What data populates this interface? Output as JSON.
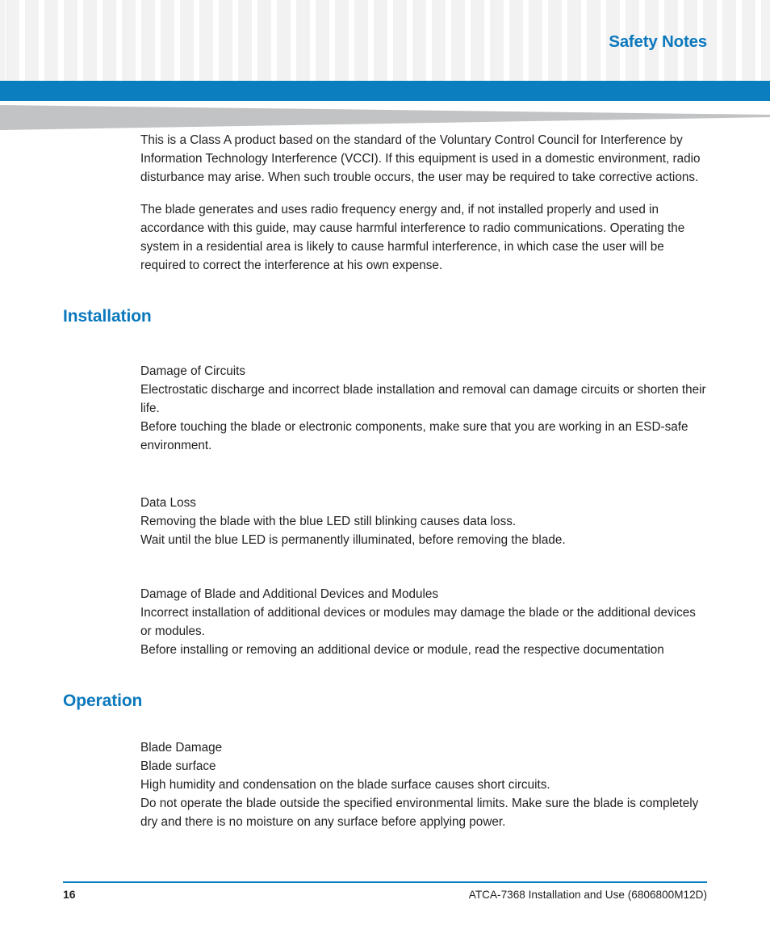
{
  "header": {
    "title": "Safety Notes",
    "accent_color": "#0b7ebf",
    "heading_color": "#0b78bd"
  },
  "body": {
    "paragraphs": [
      "This is a Class A product based on the standard of the Voluntary Control Council for Interference by Information Technology Interference (VCCI). If this equipment is used in a domestic environment, radio disturbance may arise. When such trouble occurs, the user may be required to take corrective actions.",
      "The blade generates and uses radio frequency energy and, if not installed properly and used in accordance with this guide, may cause harmful interference to radio communications. Operating the system in a residential area is likely to cause harmful interference, in which case the user will be required to correct the interference at his own expense."
    ],
    "sections": [
      {
        "heading": "Installation",
        "blocks": [
          {
            "title": "Damage of Circuits",
            "lines": [
              "Electrostatic discharge and incorrect blade installation and removal can damage circuits or shorten their life.",
              "Before touching the blade or electronic components, make sure that you are working in an ESD-safe environment."
            ]
          },
          {
            "title": "Data Loss",
            "lines": [
              "Removing the blade with the blue LED still blinking causes data loss.",
              "Wait until the blue LED is permanently illuminated, before removing the blade."
            ]
          },
          {
            "title": "Damage of Blade and Additional Devices and Modules",
            "lines": [
              "Incorrect installation of additional devices or modules may damage the blade or the additional devices or modules.",
              "Before installing or removing an additional device or module, read the respective documentation"
            ]
          }
        ]
      },
      {
        "heading": "Operation",
        "blocks": [
          {
            "title": "Blade Damage",
            "lines": [
              "Blade surface",
              "High humidity and condensation on the blade surface causes short circuits.",
              "Do not operate the blade outside the specified environmental limits. Make sure the blade is completely dry and there is no moisture on any surface before applying power."
            ]
          }
        ]
      }
    ]
  },
  "footer": {
    "page_number": "16",
    "document_title": "ATCA-7368 Installation and Use (6806800M12D)"
  }
}
